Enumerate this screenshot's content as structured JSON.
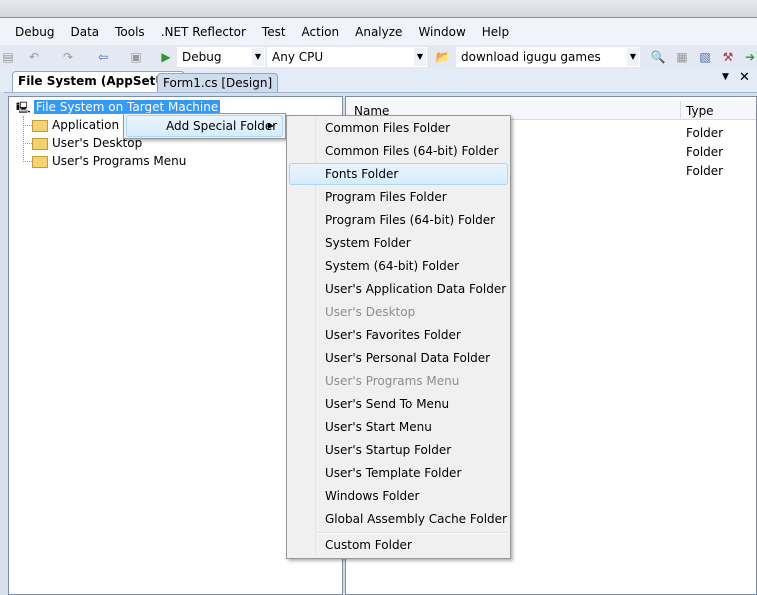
{
  "menubar": {
    "items": [
      "Debug",
      "Data",
      "Tools",
      ".NET Reflector",
      "Test",
      "Action",
      "Analyze",
      "Window",
      "Help"
    ]
  },
  "toolbar": {
    "config": "Debug",
    "platform": "Any CPU",
    "find": "download igugu games"
  },
  "tabs": [
    {
      "label": "File System (AppSetUp)",
      "active": true
    },
    {
      "label": "Form1.cs [Design]",
      "active": false
    }
  ],
  "tree": {
    "root": "File System on Target Machine",
    "children": [
      "Application Folder",
      "User's Desktop",
      "User's Programs Menu"
    ]
  },
  "list": {
    "columns": [
      "Name",
      "Type"
    ],
    "types": [
      "Folder",
      "Folder",
      "Folder"
    ]
  },
  "context_menu": {
    "item": "Add Special Folder"
  },
  "submenu": {
    "items": [
      {
        "label": "Common Files Folder"
      },
      {
        "label": "Common Files (64-bit) Folder"
      },
      {
        "label": "Fonts Folder",
        "highlighted": true
      },
      {
        "label": "Program Files Folder"
      },
      {
        "label": "Program Files (64-bit) Folder"
      },
      {
        "label": "System Folder"
      },
      {
        "label": "System (64-bit) Folder"
      },
      {
        "label": "User's Application Data Folder"
      },
      {
        "label": "User's Desktop",
        "disabled": true
      },
      {
        "label": "User's Favorites Folder"
      },
      {
        "label": "User's Personal Data Folder"
      },
      {
        "label": "User's Programs Menu",
        "disabled": true
      },
      {
        "label": "User's Send To Menu"
      },
      {
        "label": "User's Start Menu"
      },
      {
        "label": "User's Startup Folder"
      },
      {
        "label": "User's Template Folder"
      },
      {
        "label": "Windows Folder"
      },
      {
        "label": "Global Assembly Cache Folder"
      }
    ],
    "last": "Custom Folder"
  }
}
